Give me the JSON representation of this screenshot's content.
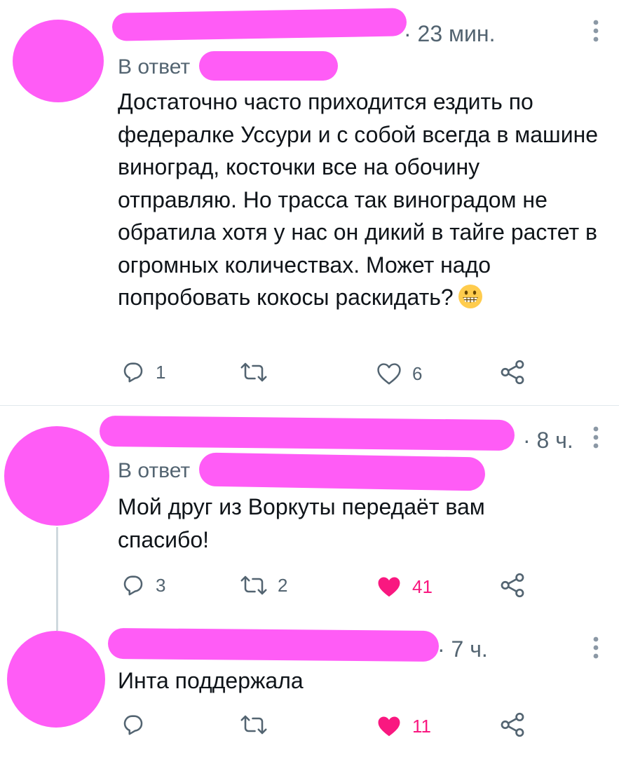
{
  "tweets": [
    {
      "time": "· 23 мин.",
      "reply_prefix": "В ответ",
      "text": "Достаточно часто приходится ездить по федералке Уссури и с собой всегда в машине виноград, косточки все на обочину отправляю. Но трасса так виноградом не обратила хотя у нас он дикий в тайге растет в огромных количествах. Может надо попробовать кокосы раскидать?",
      "emoji": "grinning-face-icon",
      "replies": "1",
      "retweets": "",
      "likes": "6",
      "liked": false
    },
    {
      "time": "· 8 ч.",
      "reply_prefix": "В ответ",
      "text": "Мой друг из Воркуты передаёт вам спасибо!",
      "replies": "3",
      "retweets": "2",
      "likes": "41",
      "liked": true
    },
    {
      "time": "· 7 ч.",
      "text": "Инта поддержала",
      "replies": "",
      "retweets": "",
      "likes": "11",
      "liked": true
    }
  ],
  "colors": {
    "redaction": "#ff5cf6",
    "like": "#f91880",
    "secondary_text": "#536471",
    "primary_text": "#0f1419"
  }
}
